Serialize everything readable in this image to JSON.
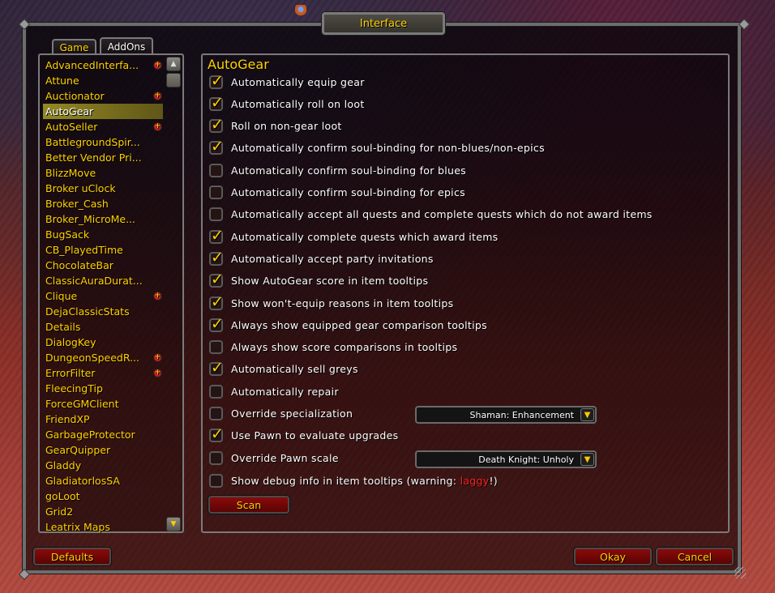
{
  "window": {
    "title": "Interface"
  },
  "tabs": [
    {
      "label": "Game",
      "active": false
    },
    {
      "label": "AddOns",
      "active": true
    }
  ],
  "addon_list": {
    "items": [
      {
        "label": "AdvancedInterfa...",
        "expandable": true,
        "selected": false
      },
      {
        "label": "Attune",
        "expandable": false,
        "selected": false
      },
      {
        "label": "Auctionator",
        "expandable": true,
        "selected": false
      },
      {
        "label": "AutoGear",
        "expandable": false,
        "selected": true
      },
      {
        "label": "AutoSeller",
        "expandable": true,
        "selected": false
      },
      {
        "label": "BattlegroundSpir...",
        "expandable": false,
        "selected": false
      },
      {
        "label": "Better Vendor Pri...",
        "expandable": false,
        "selected": false
      },
      {
        "label": "BlizzMove",
        "expandable": false,
        "selected": false
      },
      {
        "label": "Broker uClock",
        "expandable": false,
        "selected": false
      },
      {
        "label": "Broker_Cash",
        "expandable": false,
        "selected": false
      },
      {
        "label": "Broker_MicroMe...",
        "expandable": false,
        "selected": false
      },
      {
        "label": "BugSack",
        "expandable": false,
        "selected": false
      },
      {
        "label": "CB_PlayedTime",
        "expandable": false,
        "selected": false
      },
      {
        "label": "ChocolateBar",
        "expandable": false,
        "selected": false
      },
      {
        "label": "ClassicAuraDurat...",
        "expandable": false,
        "selected": false
      },
      {
        "label": "Clique",
        "expandable": true,
        "selected": false
      },
      {
        "label": "DejaClassicStats",
        "expandable": false,
        "selected": false
      },
      {
        "label": "Details",
        "expandable": false,
        "selected": false
      },
      {
        "label": "DialogKey",
        "expandable": false,
        "selected": false
      },
      {
        "label": "DungeonSpeedR...",
        "expandable": true,
        "selected": false
      },
      {
        "label": "ErrorFilter",
        "expandable": true,
        "selected": false
      },
      {
        "label": "FleecingTip",
        "expandable": false,
        "selected": false
      },
      {
        "label": "ForceGMClient",
        "expandable": false,
        "selected": false
      },
      {
        "label": "FriendXP",
        "expandable": false,
        "selected": false
      },
      {
        "label": "GarbageProtector",
        "expandable": false,
        "selected": false
      },
      {
        "label": "GearQuipper",
        "expandable": false,
        "selected": false
      },
      {
        "label": "Gladdy",
        "expandable": false,
        "selected": false
      },
      {
        "label": "GladiatorlosSA",
        "expandable": false,
        "selected": false
      },
      {
        "label": "goLoot",
        "expandable": false,
        "selected": false
      },
      {
        "label": "Grid2",
        "expandable": false,
        "selected": false
      },
      {
        "label": "Leatrix Maps",
        "expandable": false,
        "selected": false
      }
    ]
  },
  "panel": {
    "title": "AutoGear",
    "options": [
      {
        "label": "Automatically equip gear",
        "checked": true
      },
      {
        "label": "Automatically roll on loot",
        "checked": true
      },
      {
        "label": "Roll on non-gear loot",
        "checked": true
      },
      {
        "label": "Automatically confirm soul-binding for non-blues/non-epics",
        "checked": true
      },
      {
        "label": "Automatically confirm soul-binding for blues",
        "checked": false
      },
      {
        "label": "Automatically confirm soul-binding for epics",
        "checked": false
      },
      {
        "label": "Automatically accept all quests and complete quests which do not award items",
        "checked": false
      },
      {
        "label": "Automatically complete quests which award items",
        "checked": true
      },
      {
        "label": "Automatically accept party invitations",
        "checked": true
      },
      {
        "label": "Show AutoGear score in item tooltips",
        "checked": true
      },
      {
        "label": "Show won't-equip reasons in item tooltips",
        "checked": true
      },
      {
        "label": "Always show equipped gear comparison tooltips",
        "checked": true
      },
      {
        "label": "Always show score comparisons in tooltips",
        "checked": false
      },
      {
        "label": "Automatically sell greys",
        "checked": true
      },
      {
        "label": "Automatically repair",
        "checked": false
      },
      {
        "label": "Override specialization",
        "checked": false
      },
      {
        "label": "Use Pawn to evaluate upgrades",
        "checked": true
      },
      {
        "label": "Override Pawn scale",
        "checked": false
      }
    ],
    "debug_option": {
      "label_prefix": "Show debug info in item tooltips (warning: ",
      "label_warning": "laggy",
      "label_suffix": "!)",
      "checked": false,
      "warning_color": "#ff2020"
    },
    "specialization_dropdown": {
      "value": "Shaman: Enhancement"
    },
    "pawn_scale_dropdown": {
      "value": "Death Knight: Unholy"
    },
    "scan_button": "Scan"
  },
  "footer": {
    "defaults_button": "Defaults",
    "okay_button": "Okay",
    "cancel_button": "Cancel"
  },
  "colors": {
    "gold_text": "#ffd200",
    "selected_row": "#bfb428",
    "button_red": "#8a0a0a"
  }
}
